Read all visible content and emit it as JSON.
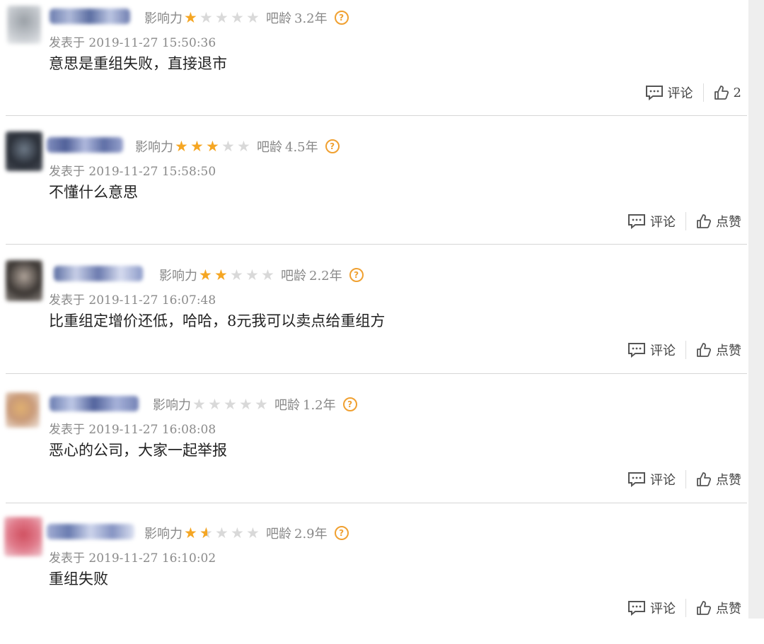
{
  "labels": {
    "influence": "影响力",
    "age": "吧龄",
    "comment": "评论",
    "help_icon": "?"
  },
  "icons": {
    "comment": "comment-bubble-icon",
    "like": "thumbs-up-icon",
    "help": "question-circle-icon",
    "star": "star-icon"
  },
  "colors": {
    "star": "#f5a623",
    "star_empty": "#d9d9d9"
  },
  "comments": [
    {
      "influence_stars": 1,
      "age": "3.2年",
      "time": "发表于 2019-11-27 15:50:36",
      "text": "意思是重组失败，直接退市",
      "comment_label": "评论",
      "like_label": "2"
    },
    {
      "influence_stars": 3,
      "age": "4.5年",
      "time": "发表于 2019-11-27 15:58:50",
      "text": "不懂什么意思",
      "comment_label": "评论",
      "like_label": "点赞"
    },
    {
      "influence_stars": 2,
      "age": "2.2年",
      "time": "发表于 2019-11-27 16:07:48",
      "text": "比重组定增价还低，哈哈，8元我可以卖点给重组方",
      "comment_label": "评论",
      "like_label": "点赞"
    },
    {
      "influence_stars": 0,
      "age": "1.2年",
      "time": "发表于 2019-11-27 16:08:08",
      "text": "恶心的公司，大家一起举报",
      "comment_label": "评论",
      "like_label": "点赞"
    },
    {
      "influence_stars": 1.5,
      "age": "2.9年",
      "time": "发表于 2019-11-27 16:10:02",
      "text": "重组失败",
      "comment_label": "评论",
      "like_label": "点赞"
    }
  ]
}
